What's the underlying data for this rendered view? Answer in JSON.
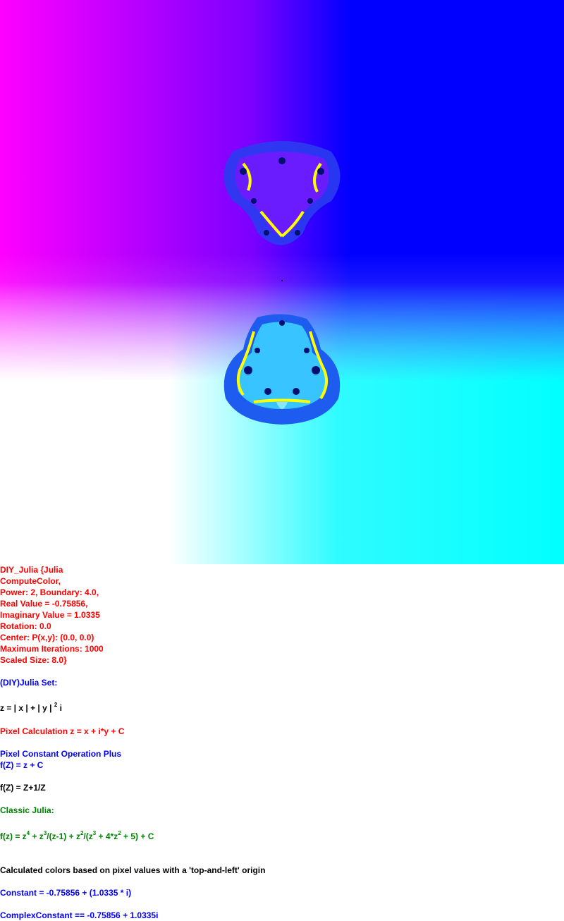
{
  "colors": {
    "red": "#ff0000",
    "blue": "#0000ff",
    "black": "#000000",
    "green": "#008000",
    "magenta": "#ff00ff",
    "cyan": "#00ffff",
    "fractal_dark": "#1e2fe6",
    "fractal_mid": "#4d6bff",
    "fractal_yellow": "#ffff00"
  },
  "params": {
    "line1": "DIY_Julia {Julia",
    "line2": "ComputeColor,",
    "line3": "Power: 2, Boundary: 4.0,",
    "line4": "Real Value = -0.75856,",
    "line5": "Imaginary Value = 1.0335",
    "line6": "Rotation: 0.0",
    "line7": "Center: P(x,y): (0.0, 0.0)",
    "line8": "Maximum Iterations: 1000",
    "line9": "Scaled Size: 8.0}"
  },
  "diy_julia_heading": "(DIY)Julia Set:",
  "formula_abs": {
    "prefix": "z = | x | + | y | ",
    "exp": "2",
    "suffix": " i"
  },
  "pixel_calc": "Pixel Calculation z = x + i*y + C",
  "pixel_constant_op": "Pixel Constant Operation Plus",
  "fz_plus_c": "f(Z) = z + C",
  "fz_inverse": "f(Z) = Z+1/Z",
  "classic_julia_heading": "Classic Julia:",
  "classic_formula": {
    "p1": "f(z) = z",
    "e1": "4",
    "p2": " + z",
    "e2": "3",
    "p3": "/(z-1) + z",
    "e3": "2",
    "p4": "/(z",
    "e4": "3",
    "p5": " + 4*z",
    "e5": "2",
    "p6": " + 5) + C"
  },
  "calc_colors_note": "Calculated colors based on pixel values with a 'top-and-left' origin",
  "constant_line": "Constant = -0.75856 + (1.0335 * i)",
  "complex_constant_line": "ComplexConstant == -0.75856 + 1.0335i"
}
